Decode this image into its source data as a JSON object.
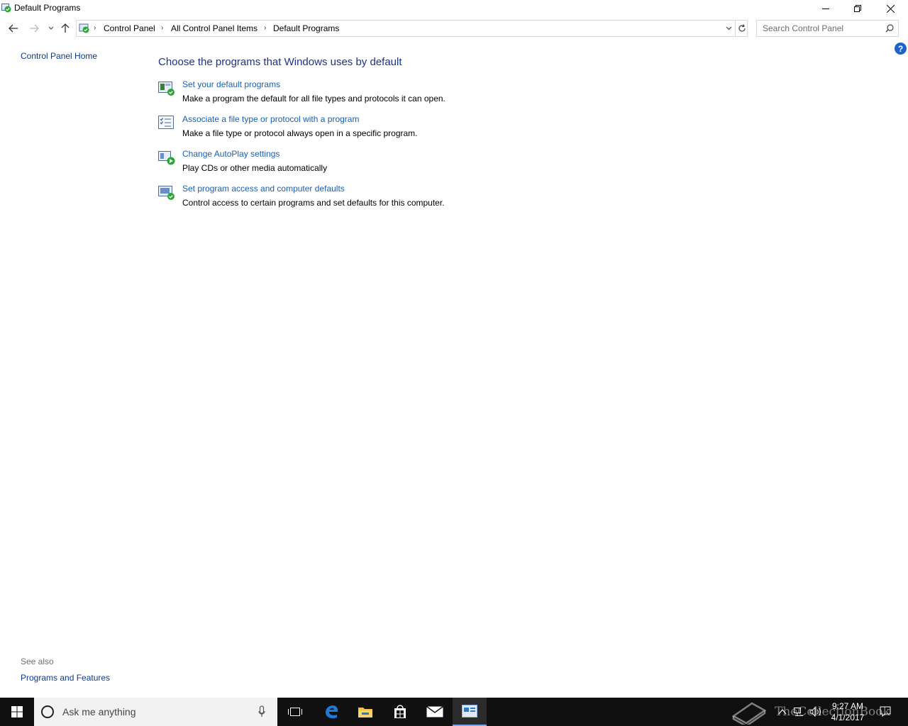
{
  "window": {
    "title": "Default Programs",
    "controls": {
      "minimize": "minimize",
      "maximize": "restore",
      "close": "close"
    }
  },
  "address": {
    "crumbs": [
      "Control Panel",
      "All Control Panel Items",
      "Default Programs"
    ],
    "search_placeholder": "Search Control Panel"
  },
  "left_pane": {
    "home_link": "Control Panel Home",
    "see_also_label": "See also",
    "see_also_links": [
      "Programs and Features"
    ]
  },
  "main": {
    "heading": "Choose the programs that Windows uses by default",
    "tasks": [
      {
        "link": "Set your default programs",
        "desc": "Make a program the default for all file types and protocols it can open.",
        "icon": "default-programs-icon"
      },
      {
        "link": "Associate a file type or protocol with a program",
        "desc": "Make a file type or protocol always open in a specific program.",
        "icon": "file-association-icon"
      },
      {
        "link": "Change AutoPlay settings",
        "desc": "Play CDs or other media automatically",
        "icon": "autoplay-icon"
      },
      {
        "link": "Set program access and computer defaults",
        "desc": "Control access to certain programs and set defaults for this computer.",
        "icon": "program-access-icon"
      }
    ]
  },
  "taskbar": {
    "search_text": "Ask me anything",
    "clock_time": "9:27 AM",
    "clock_date": "4/1/2017",
    "watermark": "TheCollectionBook"
  },
  "colors": {
    "link": "#1a5fb4",
    "heading": "#1e3287",
    "taskbar": "#101010"
  }
}
